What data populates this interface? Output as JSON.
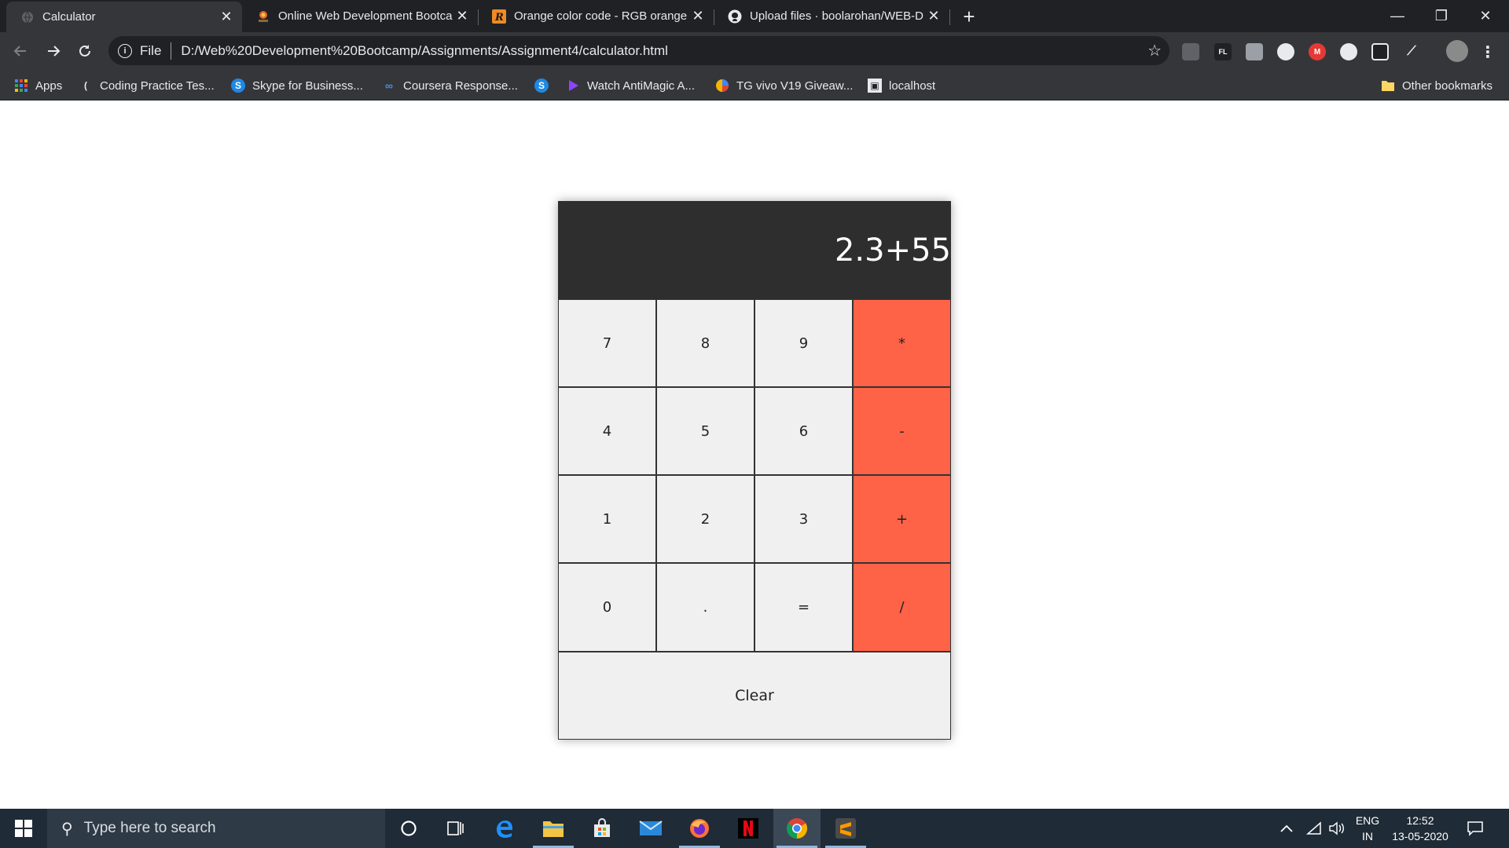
{
  "browser": {
    "tabs": [
      {
        "title": "Calculator",
        "active": true
      },
      {
        "title": "Online Web Development Bootcamp"
      },
      {
        "title": "Orange color code - RGB orange"
      },
      {
        "title": "Upload files · boolarohan/WEB-D"
      }
    ],
    "new_tab_label": "+",
    "window_controls": {
      "minimize": "—",
      "restore": "❐",
      "close": "✕"
    }
  },
  "toolbar": {
    "url_scheme": "File",
    "url": "D:/Web%20Development%20Bootcamp/Assignments/Assignment4/calculator.html"
  },
  "bookmarks": [
    {
      "label": "Apps"
    },
    {
      "label": "Coding Practice Tes..."
    },
    {
      "label": "Skype for Business..."
    },
    {
      "label": "Coursera Response..."
    },
    {
      "label": ""
    },
    {
      "label": "Watch AntiMagic A..."
    },
    {
      "label": "TG vivo V19 Giveaw..."
    },
    {
      "label": "localhost"
    }
  ],
  "other_bookmarks": "Other bookmarks",
  "calculator": {
    "display": "2.3+55",
    "keys": [
      "7",
      "8",
      "9",
      "*",
      "4",
      "5",
      "6",
      "-",
      "1",
      "2",
      "3",
      "+",
      "0",
      ".",
      "=",
      "/"
    ],
    "clear_label": "Clear",
    "operator_color": "#ff6347",
    "display_color": "#2e2e2e"
  },
  "taskbar": {
    "search_placeholder": "Type here to search",
    "language_top": "ENG",
    "language_bottom": "IN",
    "time": "12:52",
    "date": "13-05-2020"
  }
}
